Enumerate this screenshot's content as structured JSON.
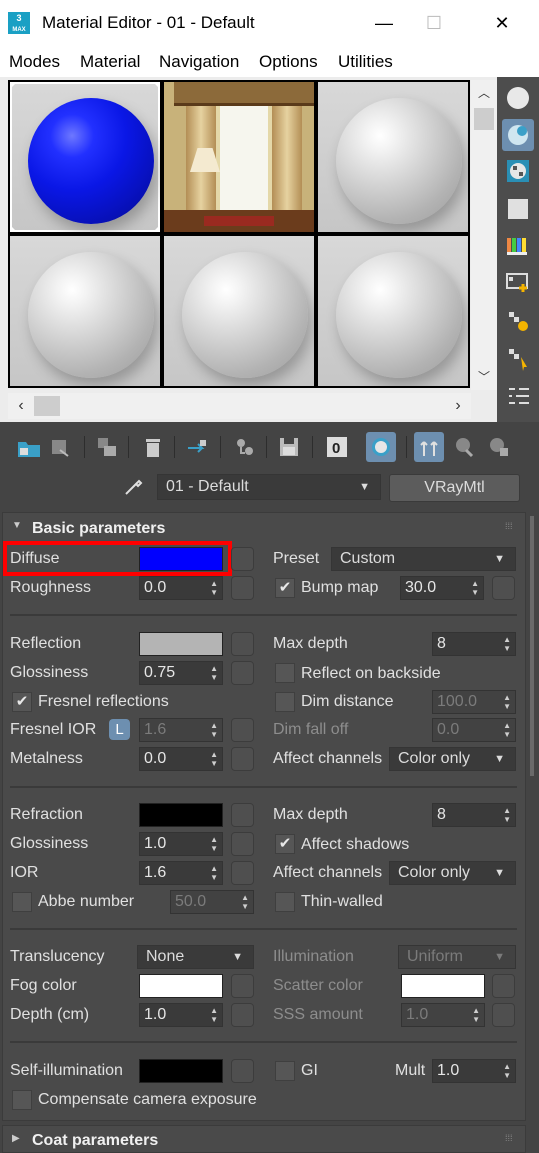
{
  "window": {
    "title": "Material Editor - 01 - Default",
    "app_icon_text": "3\nMAX",
    "minimize": "—",
    "maximize": "☐",
    "close": "✕"
  },
  "menu": [
    "Modes",
    "Material",
    "Navigation",
    "Options",
    "Utilities"
  ],
  "sample_slots": [
    {
      "kind": "blue-sphere"
    },
    {
      "kind": "room-scene"
    },
    {
      "kind": "grey-sphere"
    },
    {
      "kind": "grey-sphere"
    },
    {
      "kind": "grey-sphere"
    },
    {
      "kind": "grey-sphere"
    }
  ],
  "material_selector": {
    "name": "01 - Default",
    "type_button": "VRayMtl"
  },
  "rollouts": {
    "basic": {
      "title": "Basic parameters",
      "diffuse_label": "Diffuse",
      "diffuse_color": "#0000ff",
      "roughness_label": "Roughness",
      "roughness_value": "0.0",
      "preset_label": "Preset",
      "preset_value": "Custom",
      "bump_label": "Bump map",
      "bump_checked": true,
      "bump_value": "30.0",
      "reflection_label": "Reflection",
      "reflection_color": "#b4b4b4",
      "refl_glossiness_label": "Glossiness",
      "refl_glossiness_value": "0.75",
      "fresnel_label": "Fresnel reflections",
      "fresnel_checked": true,
      "fresnel_ior_label": "Fresnel IOR",
      "fresnel_ior_lock": "L",
      "fresnel_ior_value": "1.6",
      "metalness_label": "Metalness",
      "metalness_value": "0.0",
      "refl_max_depth_label": "Max depth",
      "refl_max_depth_value": "8",
      "reflect_backside_label": "Reflect on backside",
      "dim_distance_label": "Dim distance",
      "dim_distance_value": "100.0",
      "dim_falloff_label": "Dim fall off",
      "dim_falloff_value": "0.0",
      "refl_affect_label": "Affect channels",
      "refl_affect_value": "Color only",
      "refraction_label": "Refraction",
      "refraction_color": "#000000",
      "refr_glossiness_label": "Glossiness",
      "refr_glossiness_value": "1.0",
      "ior_label": "IOR",
      "ior_value": "1.6",
      "abbe_label": "Abbe number",
      "abbe_value": "50.0",
      "refr_max_depth_label": "Max depth",
      "refr_max_depth_value": "8",
      "affect_shadows_label": "Affect shadows",
      "affect_shadows_checked": true,
      "refr_affect_label": "Affect channels",
      "refr_affect_value": "Color only",
      "thin_walled_label": "Thin-walled",
      "translucency_label": "Translucency",
      "translucency_value": "None",
      "fog_color_label": "Fog color",
      "fog_color": "#ffffff",
      "depth_label": "Depth (cm)",
      "depth_value": "1.0",
      "illumination_label": "Illumination",
      "illumination_value": "Uniform",
      "scatter_color_label": "Scatter color",
      "scatter_color": "#ffffff",
      "sss_amount_label": "SSS amount",
      "sss_amount_value": "1.0",
      "self_illum_label": "Self-illumination",
      "self_illum_color": "#000000",
      "gi_label": "GI",
      "mult_label": "Mult",
      "mult_value": "1.0",
      "compensate_label": "Compensate camera exposure"
    },
    "coat": {
      "title": "Coat parameters"
    }
  },
  "accent_color": "#ff0000"
}
